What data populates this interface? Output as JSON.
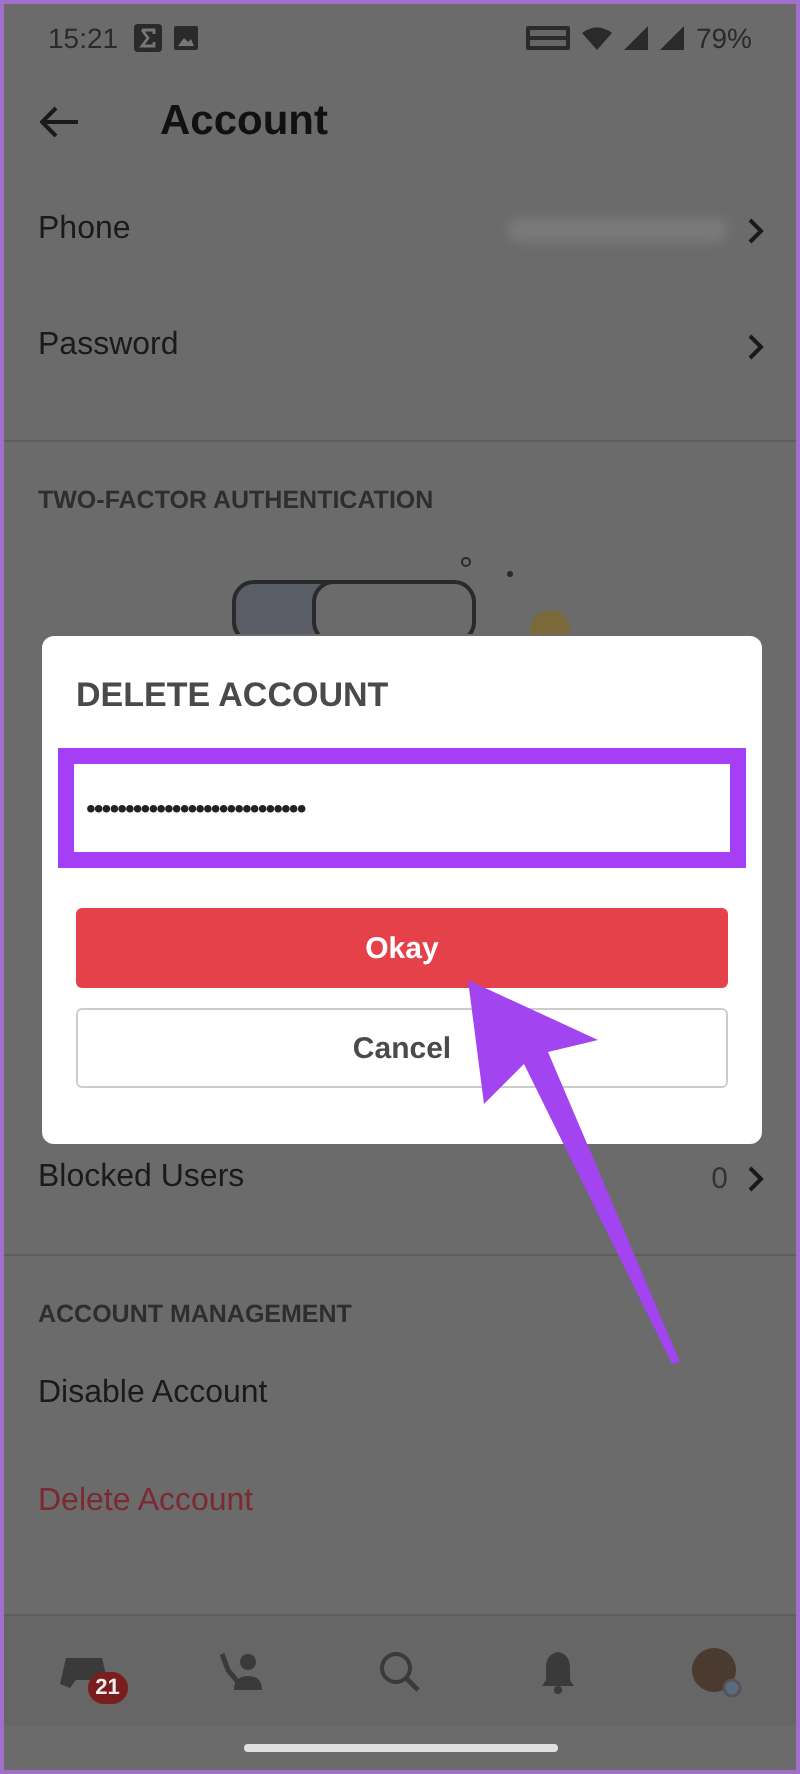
{
  "status_bar": {
    "time": "15:21",
    "battery": "79%"
  },
  "header": {
    "title": "Account"
  },
  "rows": [
    {
      "label": "Phone",
      "kind": "blurred"
    },
    {
      "label": "Password",
      "kind": "plain"
    }
  ],
  "two_factor": {
    "heading": "TWO-FACTOR AUTHENTICATION"
  },
  "blocked": {
    "label": "Blocked Users",
    "count": "0"
  },
  "management": {
    "heading": "ACCOUNT MANAGEMENT",
    "items": [
      {
        "label": "Disable Account",
        "kind": "normal"
      },
      {
        "label": "Delete Account",
        "kind": "danger"
      }
    ]
  },
  "nav": {
    "items": [
      {
        "kind": "home",
        "badge": "21"
      },
      {
        "kind": "friends"
      },
      {
        "kind": "search"
      },
      {
        "kind": "bell"
      },
      {
        "kind": "avatar"
      }
    ]
  },
  "dialog": {
    "title": "DELETE ACCOUNT",
    "password": "••••••••••••••••••••••••••••",
    "buttons": [
      {
        "label": "Okay",
        "kind": "primary"
      },
      {
        "label": "Cancel",
        "kind": "secondary"
      }
    ]
  }
}
